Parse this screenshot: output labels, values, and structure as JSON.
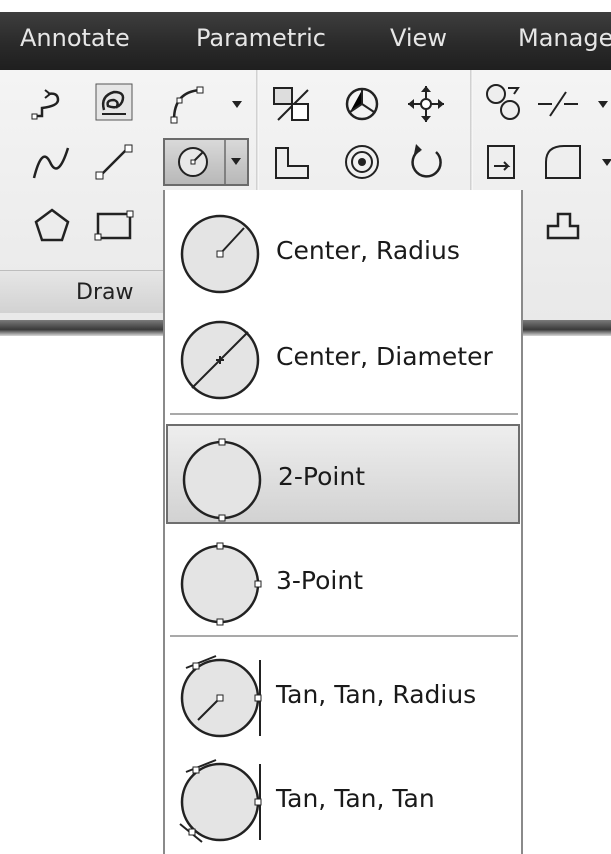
{
  "ribbon": {
    "tabs": [
      {
        "label": "Annotate"
      },
      {
        "label": "Parametric"
      },
      {
        "label": "View"
      },
      {
        "label": "Manage"
      }
    ],
    "panel_label": "Draw"
  },
  "circle_menu": {
    "items": [
      {
        "label": "Center, Radius",
        "icon": "circle-center-radius-icon"
      },
      {
        "label": "Center, Diameter",
        "icon": "circle-center-diameter-icon"
      },
      {
        "label": "2-Point",
        "icon": "circle-2-point-icon",
        "selected": true
      },
      {
        "label": "3-Point",
        "icon": "circle-3-point-icon"
      },
      {
        "label": "Tan, Tan, Radius",
        "icon": "circle-tan-tan-radius-icon"
      },
      {
        "label": "Tan, Tan, Tan",
        "icon": "circle-tan-tan-tan-icon"
      }
    ]
  },
  "colors": {
    "tab_bar": "#2e2e2e",
    "ribbon_bg": "#eeeeee",
    "selected_item": "#dcdcdc"
  }
}
